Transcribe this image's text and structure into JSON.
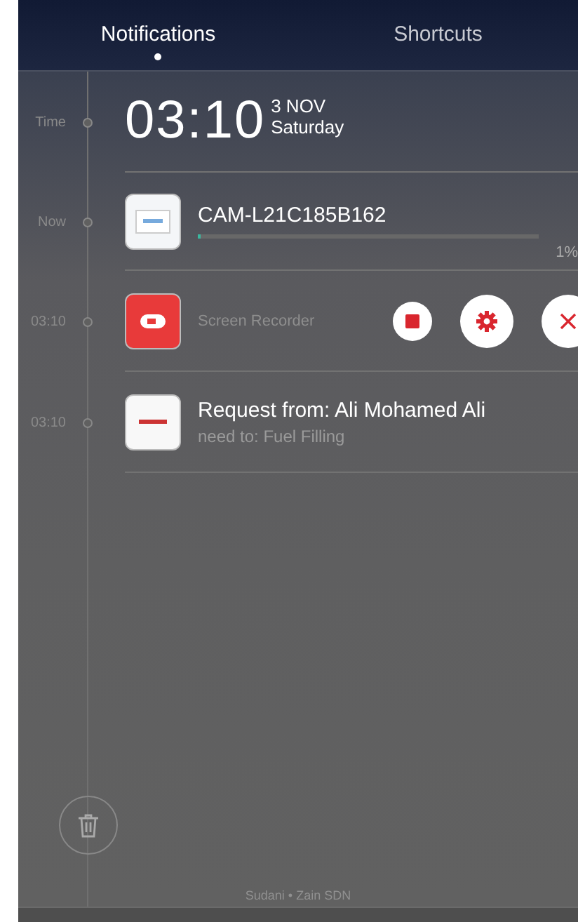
{
  "tabs": [
    {
      "label": "Notifications",
      "selected": true
    },
    {
      "label": "Shortcuts",
      "selected": false
    }
  ],
  "clock": {
    "label": "Time",
    "time": "03:10",
    "date": "3 NOV",
    "weekday": "Saturday"
  },
  "notifications": [
    {
      "kind": "progress",
      "label": "Now",
      "title": "CAM-L21C185B162",
      "level": 0.01,
      "reading": "1%"
    },
    {
      "kind": "controls",
      "label": "03:10",
      "title": "Screen Recorder"
    },
    {
      "kind": "message",
      "label": "03:10",
      "title": "Request from: Ali Mohamed Ali",
      "text": "need to: Fuel Filling"
    }
  ],
  "carrier": "Sudani • Zain SDN"
}
